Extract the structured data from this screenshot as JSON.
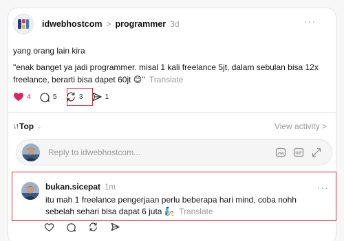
{
  "post": {
    "author": "idwebhostcom",
    "separator": ">",
    "community": "programmer",
    "time": "3d",
    "more": "···",
    "title": "yang orang lain kira",
    "body": "\"enak banget ya jadi programmer. misal 1 kali freelance 5jt, dalam sebulan bisa 12x freelance, berarti bisa dapet 60jt 😊\"",
    "translate": "Translate",
    "actions": {
      "likes": "4",
      "comments": "5",
      "reposts": "3",
      "shares": "1"
    },
    "colors": {
      "like": "#e0245e",
      "highlight": "#e1252f"
    }
  },
  "sort": {
    "arrows": "↓↑",
    "label": "Top",
    "caret": "⌄",
    "view_activity": "View activity >"
  },
  "reply": {
    "placeholder": "Reply to idwebhostcom...",
    "icons": [
      "image-icon",
      "gif-icon",
      "expand-icon"
    ],
    "gif_label": "GIF"
  },
  "comment": {
    "author": "bukan.sicepat",
    "time": "1m",
    "more": "···",
    "body": "itu mah 1 freelance pengerjaan perlu beberapa hari mind, coba nohh sebelah sehari bisa dapat 6 juta 🧞",
    "translate": "Translate"
  }
}
